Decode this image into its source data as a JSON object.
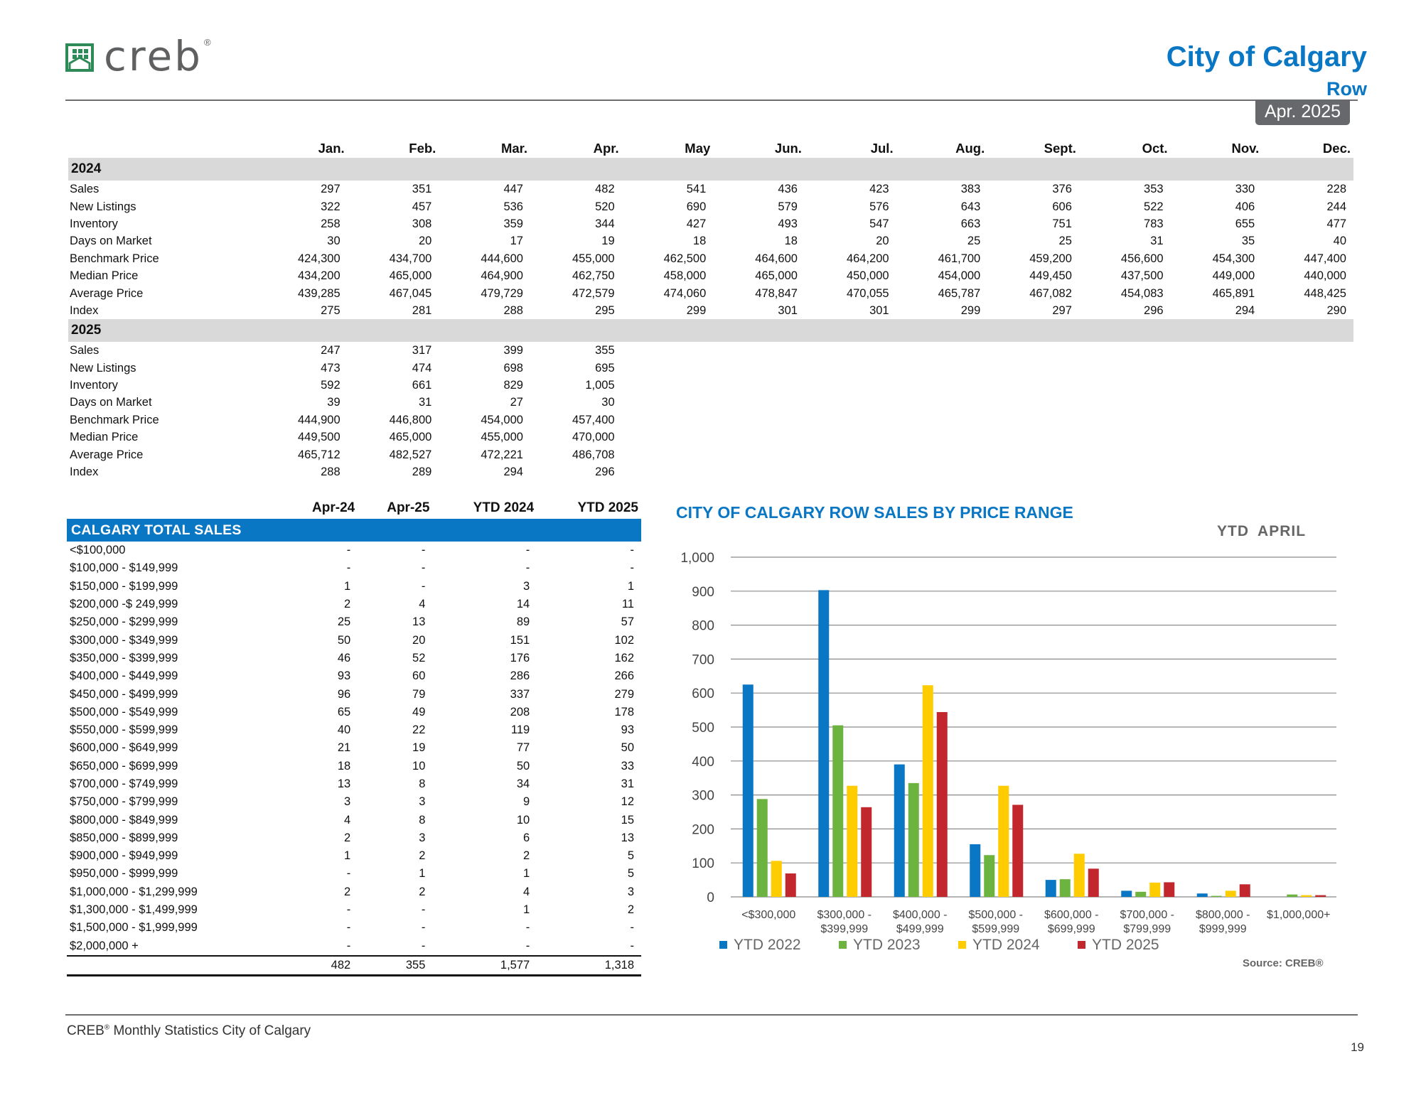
{
  "header": {
    "logo_text": "creb",
    "logo_mark": "®",
    "city": "City of Calgary",
    "property_type": "Row",
    "date_badge": "Apr. 2025"
  },
  "monthly": {
    "months": [
      "Jan.",
      "Feb.",
      "Mar.",
      "Apr.",
      "May",
      "Jun.",
      "Jul.",
      "Aug.",
      "Sept.",
      "Oct.",
      "Nov.",
      "Dec."
    ],
    "years": [
      {
        "year": "2024",
        "rows": [
          {
            "label": "Sales",
            "values": [
              "297",
              "351",
              "447",
              "482",
              "541",
              "436",
              "423",
              "383",
              "376",
              "353",
              "330",
              "228"
            ]
          },
          {
            "label": "New Listings",
            "values": [
              "322",
              "457",
              "536",
              "520",
              "690",
              "579",
              "576",
              "643",
              "606",
              "522",
              "406",
              "244"
            ]
          },
          {
            "label": "Inventory",
            "values": [
              "258",
              "308",
              "359",
              "344",
              "427",
              "493",
              "547",
              "663",
              "751",
              "783",
              "655",
              "477"
            ]
          },
          {
            "label": "Days on Market",
            "values": [
              "30",
              "20",
              "17",
              "19",
              "18",
              "18",
              "20",
              "25",
              "25",
              "31",
              "35",
              "40"
            ]
          },
          {
            "label": "Benchmark Price",
            "values": [
              "424,300",
              "434,700",
              "444,600",
              "455,000",
              "462,500",
              "464,600",
              "464,200",
              "461,700",
              "459,200",
              "456,600",
              "454,300",
              "447,400"
            ]
          },
          {
            "label": "Median Price",
            "values": [
              "434,200",
              "465,000",
              "464,900",
              "462,750",
              "458,000",
              "465,000",
              "450,000",
              "454,000",
              "449,450",
              "437,500",
              "449,000",
              "440,000"
            ]
          },
          {
            "label": "Average Price",
            "values": [
              "439,285",
              "467,045",
              "479,729",
              "472,579",
              "474,060",
              "478,847",
              "470,055",
              "465,787",
              "467,082",
              "454,083",
              "465,891",
              "448,425"
            ]
          },
          {
            "label": "Index",
            "values": [
              "275",
              "281",
              "288",
              "295",
              "299",
              "301",
              "301",
              "299",
              "297",
              "296",
              "294",
              "290"
            ]
          }
        ]
      },
      {
        "year": "2025",
        "rows": [
          {
            "label": "Sales",
            "values": [
              "247",
              "317",
              "399",
              "355",
              "",
              "",
              "",
              "",
              "",
              "",
              "",
              ""
            ]
          },
          {
            "label": "New Listings",
            "values": [
              "473",
              "474",
              "698",
              "695",
              "",
              "",
              "",
              "",
              "",
              "",
              "",
              ""
            ]
          },
          {
            "label": "Inventory",
            "values": [
              "592",
              "661",
              "829",
              "1,005",
              "",
              "",
              "",
              "",
              "",
              "",
              "",
              ""
            ]
          },
          {
            "label": "Days on Market",
            "values": [
              "39",
              "31",
              "27",
              "30",
              "",
              "",
              "",
              "",
              "",
              "",
              "",
              ""
            ]
          },
          {
            "label": "Benchmark Price",
            "values": [
              "444,900",
              "446,800",
              "454,000",
              "457,400",
              "",
              "",
              "",
              "",
              "",
              "",
              "",
              ""
            ]
          },
          {
            "label": "Median Price",
            "values": [
              "449,500",
              "465,000",
              "455,000",
              "470,000",
              "",
              "",
              "",
              "",
              "",
              "",
              "",
              ""
            ]
          },
          {
            "label": "Average Price",
            "values": [
              "465,712",
              "482,527",
              "472,221",
              "486,708",
              "",
              "",
              "",
              "",
              "",
              "",
              "",
              ""
            ]
          },
          {
            "label": "Index",
            "values": [
              "288",
              "289",
              "294",
              "296",
              "",
              "",
              "",
              "",
              "",
              "",
              "",
              ""
            ]
          }
        ]
      }
    ]
  },
  "price_ranges": {
    "columns": [
      "Apr-24",
      "Apr-25",
      "YTD 2024",
      "YTD 2025"
    ],
    "section_title": "CALGARY TOTAL SALES",
    "rows": [
      {
        "label": "<$100,000",
        "values": [
          "-",
          "-",
          "-",
          "-"
        ]
      },
      {
        "label": "$100,000 - $149,999",
        "values": [
          "-",
          "-",
          "-",
          "-"
        ]
      },
      {
        "label": "$150,000 - $199,999",
        "values": [
          "1",
          "-",
          "3",
          "1"
        ]
      },
      {
        "label": "$200,000 -$ 249,999",
        "values": [
          "2",
          "4",
          "14",
          "11"
        ]
      },
      {
        "label": "$250,000 - $299,999",
        "values": [
          "25",
          "13",
          "89",
          "57"
        ]
      },
      {
        "label": "$300,000 - $349,999",
        "values": [
          "50",
          "20",
          "151",
          "102"
        ]
      },
      {
        "label": "$350,000 - $399,999",
        "values": [
          "46",
          "52",
          "176",
          "162"
        ]
      },
      {
        "label": "$400,000 - $449,999",
        "values": [
          "93",
          "60",
          "286",
          "266"
        ]
      },
      {
        "label": "$450,000 - $499,999",
        "values": [
          "96",
          "79",
          "337",
          "279"
        ]
      },
      {
        "label": "$500,000 - $549,999",
        "values": [
          "65",
          "49",
          "208",
          "178"
        ]
      },
      {
        "label": "$550,000 - $599,999",
        "values": [
          "40",
          "22",
          "119",
          "93"
        ]
      },
      {
        "label": "$600,000 - $649,999",
        "values": [
          "21",
          "19",
          "77",
          "50"
        ]
      },
      {
        "label": "$650,000 - $699,999",
        "values": [
          "18",
          "10",
          "50",
          "33"
        ]
      },
      {
        "label": "$700,000 - $749,999",
        "values": [
          "13",
          "8",
          "34",
          "31"
        ]
      },
      {
        "label": "$750,000 - $799,999",
        "values": [
          "3",
          "3",
          "9",
          "12"
        ]
      },
      {
        "label": "$800,000 - $849,999",
        "values": [
          "4",
          "8",
          "10",
          "15"
        ]
      },
      {
        "label": "$850,000 - $899,999",
        "values": [
          "2",
          "3",
          "6",
          "13"
        ]
      },
      {
        "label": "$900,000 - $949,999",
        "values": [
          "1",
          "2",
          "2",
          "5"
        ]
      },
      {
        "label": "$950,000 - $999,999",
        "values": [
          "-",
          "1",
          "1",
          "5"
        ]
      },
      {
        "label": "$1,000,000 - $1,299,999",
        "values": [
          "2",
          "2",
          "4",
          "3"
        ]
      },
      {
        "label": "$1,300,000 - $1,499,999",
        "values": [
          "-",
          "-",
          "1",
          "2"
        ]
      },
      {
        "label": "$1,500,000 - $1,999,999",
        "values": [
          "-",
          "-",
          "-",
          "-"
        ]
      },
      {
        "label": "$2,000,000 +",
        "values": [
          "-",
          "-",
          "-",
          "-"
        ]
      }
    ],
    "totals": [
      "482",
      "355",
      "1,577",
      "1,318"
    ]
  },
  "chart_data": {
    "type": "bar",
    "title": "CITY OF CALGARY ROW SALES BY PRICE RANGE",
    "period": "YTD  APRIL",
    "categories": [
      [
        "<$300,000"
      ],
      [
        "$300,000 -",
        "$399,999"
      ],
      [
        "$400,000 -",
        "$499,999"
      ],
      [
        "$500,000 -",
        "$599,999"
      ],
      [
        "$600,000 -",
        "$699,999"
      ],
      [
        "$700,000 -",
        "$799,999"
      ],
      [
        "$800,000 -",
        "$999,999"
      ],
      [
        "$1,000,000+"
      ]
    ],
    "series": [
      {
        "name": "YTD  2022",
        "color": "#0a77c4",
        "values": [
          625,
          903,
          390,
          155,
          50,
          18,
          10,
          0
        ]
      },
      {
        "name": "YTD  2023",
        "color": "#6db33f",
        "values": [
          288,
          505,
          335,
          123,
          52,
          15,
          3,
          7
        ]
      },
      {
        "name": "YTD  2024",
        "color": "#ffcc00",
        "values": [
          106,
          327,
          623,
          327,
          127,
          42,
          18,
          5
        ]
      },
      {
        "name": "YTD  2025",
        "color": "#c1272d",
        "values": [
          69,
          264,
          544,
          271,
          83,
          43,
          37,
          5
        ]
      }
    ],
    "ylim": [
      0,
      1000
    ],
    "yticks": [
      0,
      100,
      200,
      300,
      400,
      500,
      600,
      700,
      800,
      900,
      1000
    ],
    "ytick_labels": [
      "0",
      "100",
      "200",
      "300",
      "400",
      "500",
      "600",
      "700",
      "800",
      "900",
      "1,000"
    ],
    "grid": true,
    "legend_position": "bottom",
    "source": "Source: CREB®"
  },
  "footer": {
    "brand": "CREB",
    "brand_mark": "®",
    "text": " Monthly Statistics City of Calgary",
    "page_number": "19"
  }
}
